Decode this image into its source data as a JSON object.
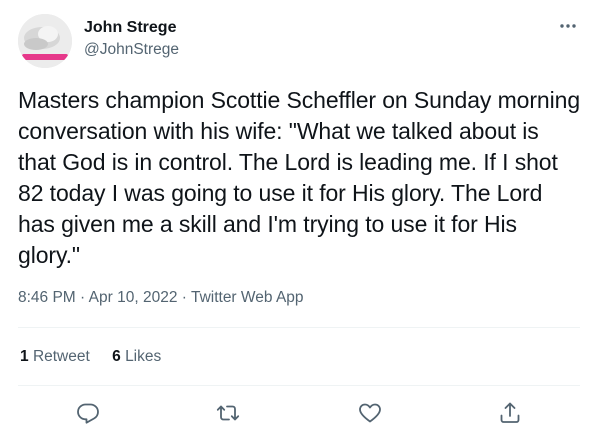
{
  "author": {
    "display_name": "John Strege",
    "handle": "@JohnStrege"
  },
  "tweet": {
    "text": "Masters champion Scottie Scheffler on Sunday morning conversation with his wife: \"What we talked about is that God is in control. The Lord is leading me. If I shot 82 today I was going to use it for His glory. The Lord has given me a skill and I'm trying to use it for His glory.\"",
    "time": "8:46 PM",
    "separator": "·",
    "date": "Apr 10, 2022",
    "source": "Twitter Web App"
  },
  "stats": {
    "retweets_count": "1",
    "retweets_label": "Retweet",
    "likes_count": "6",
    "likes_label": "Likes"
  },
  "icons": {
    "more": "more-dots-icon",
    "reply": "reply-icon",
    "retweet": "retweet-icon",
    "like": "heart-icon",
    "share": "share-icon"
  },
  "colors": {
    "text_primary": "#0f1419",
    "text_secondary": "#536471",
    "divider": "#eff3f4",
    "avatar_banner": "#e6388a"
  }
}
